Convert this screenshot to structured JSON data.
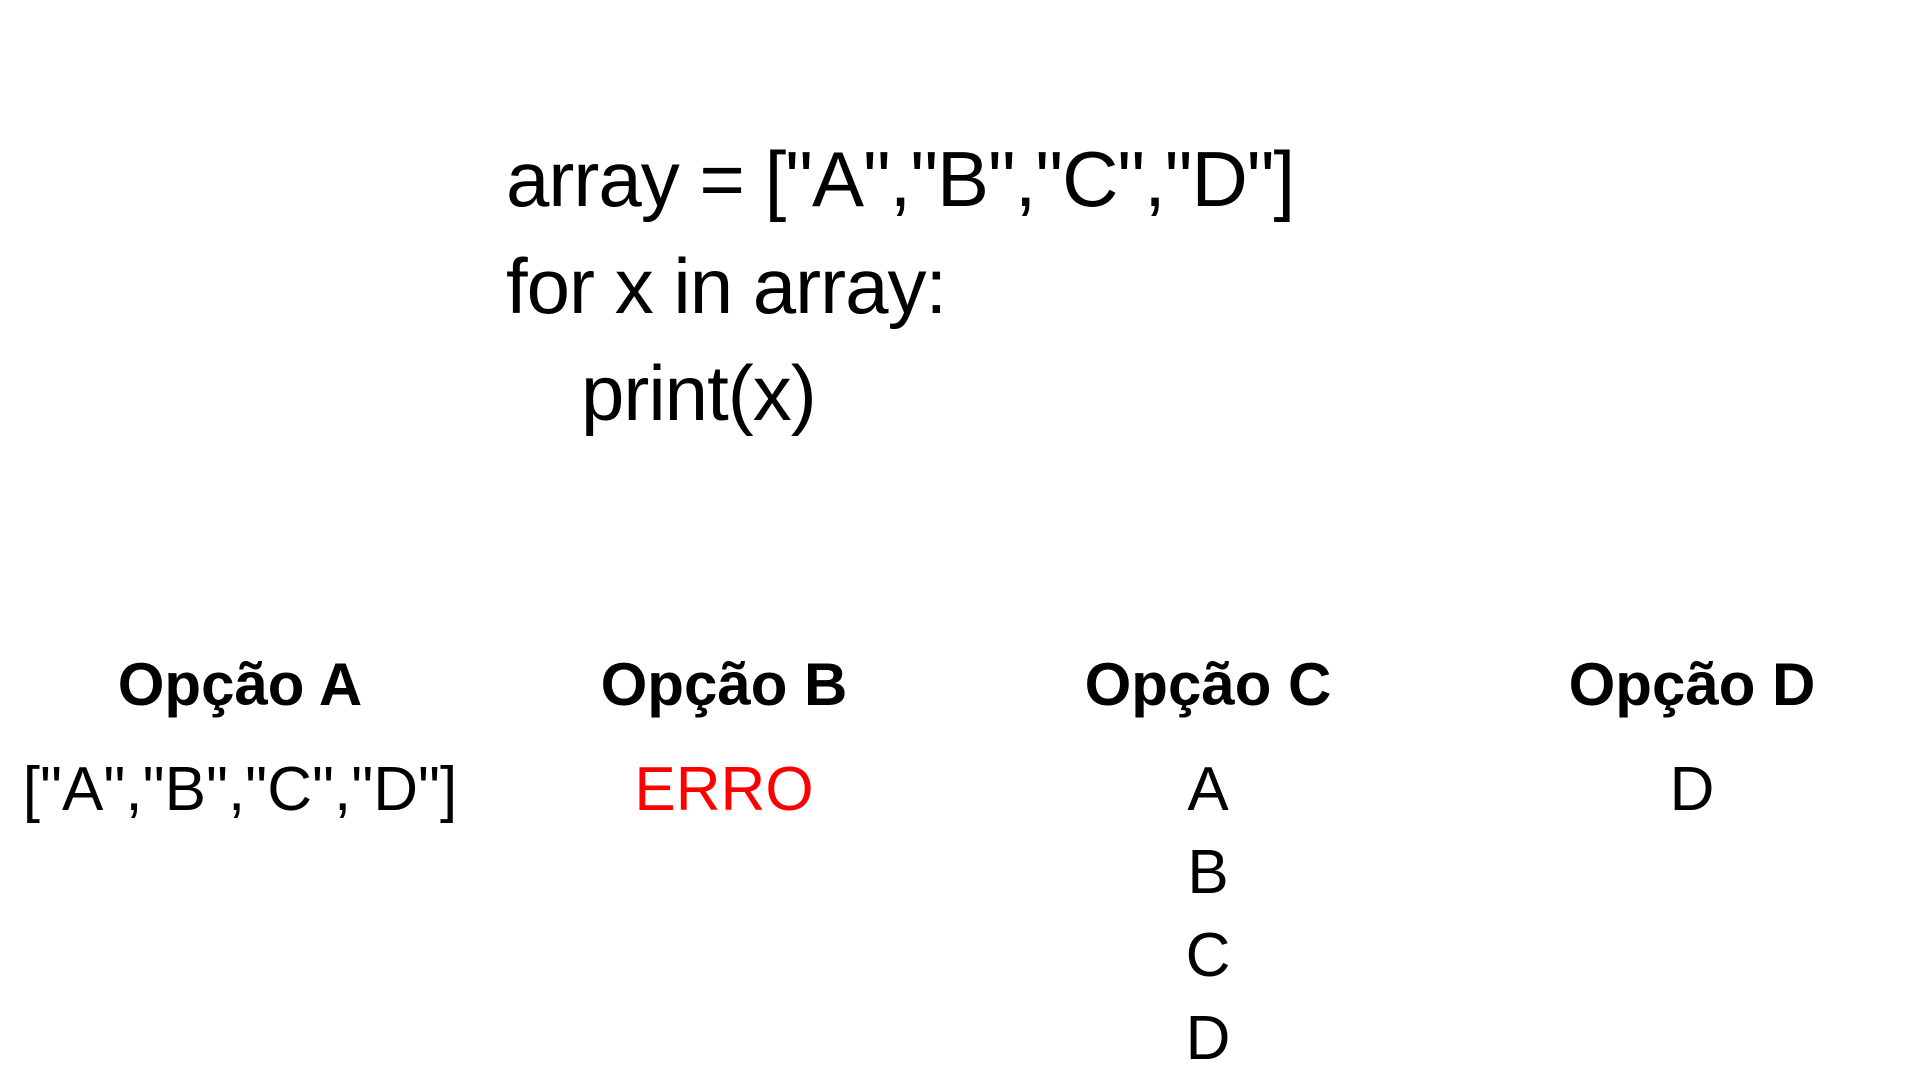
{
  "code": {
    "lines": [
      "array = [\"A\",\"B\",\"C\",\"D\"]",
      "for x in array:",
      "print(x)"
    ]
  },
  "options": [
    {
      "title": "Opção A",
      "lines": [
        "[\"A\",\"B\",\"C\",\"D\"]"
      ],
      "color": "#000000"
    },
    {
      "title": "Opção B",
      "lines": [
        "ERRO"
      ],
      "color": "#ff0000"
    },
    {
      "title": "Opção C",
      "lines": [
        "A",
        "B",
        "C",
        "D"
      ],
      "color": "#000000"
    },
    {
      "title": "Opção D",
      "lines": [
        "D"
      ],
      "color": "#000000"
    }
  ]
}
